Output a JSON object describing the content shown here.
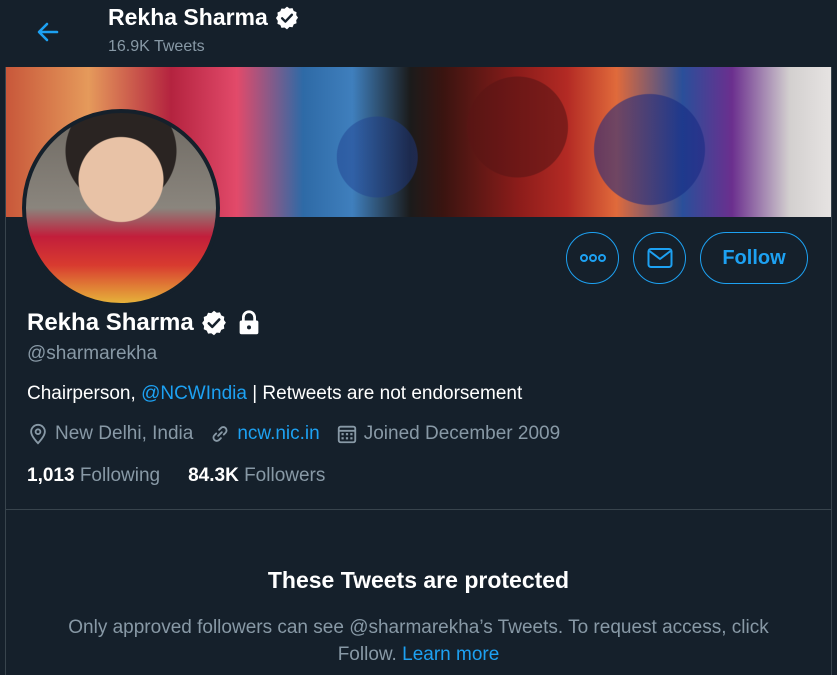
{
  "header": {
    "name": "Rekha Sharma",
    "tweet_count": "16.9K Tweets"
  },
  "profile": {
    "name": "Rekha Sharma",
    "handle": "@sharmarekha",
    "bio_prefix": "Chairperson, ",
    "bio_mention": "@NCWIndia",
    "bio_suffix": " | Retweets are not endorsement",
    "location": "New Delhi, India",
    "website": "ncw.nic.in",
    "joined": "Joined December 2009",
    "verified": true,
    "protected": true
  },
  "stats": {
    "following_count": "1,013",
    "following_label": "Following",
    "followers_count": "84.3K",
    "followers_label": "Followers"
  },
  "actions": {
    "follow_label": "Follow"
  },
  "protected_notice": {
    "title": "These Tweets are protected",
    "description": "Only approved followers can see @sharmarekha’s Tweets. To request access, click Follow.",
    "learn_more": "Learn more"
  },
  "colors": {
    "background": "#15202b",
    "accent": "#1da1f2",
    "secondary_text": "#8899a6",
    "border": "#38444d"
  },
  "icons": [
    "back-arrow-icon",
    "verified-badge-icon",
    "lock-icon",
    "more-icon",
    "mail-icon",
    "location-icon",
    "link-icon",
    "calendar-icon"
  ]
}
